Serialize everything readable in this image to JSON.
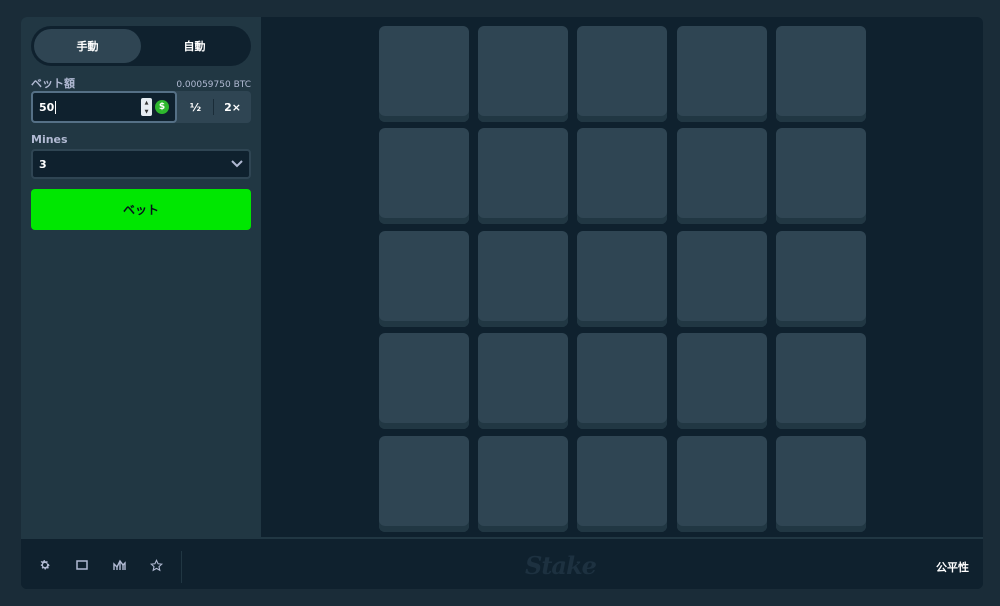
{
  "mode": {
    "manual": "手動",
    "auto": "自動"
  },
  "bet": {
    "label": "ベット額",
    "btc_value": "0.00059750 BTC",
    "amount": "50",
    "currency_symbol": "$",
    "half": "½",
    "double": "2×"
  },
  "mines": {
    "label": "Mines",
    "value": "3"
  },
  "bet_button": "ベット",
  "board": {
    "rows": 5,
    "cols": 5
  },
  "footer": {
    "icons": [
      "gear-icon",
      "theatre-mode-icon",
      "stats-icon",
      "star-icon"
    ],
    "logo": "Stake",
    "fairness": "公平性"
  },
  "colors": {
    "accent_green": "#00e701",
    "tile": "#2f4553",
    "panel": "#213743",
    "background": "#0f212e"
  }
}
